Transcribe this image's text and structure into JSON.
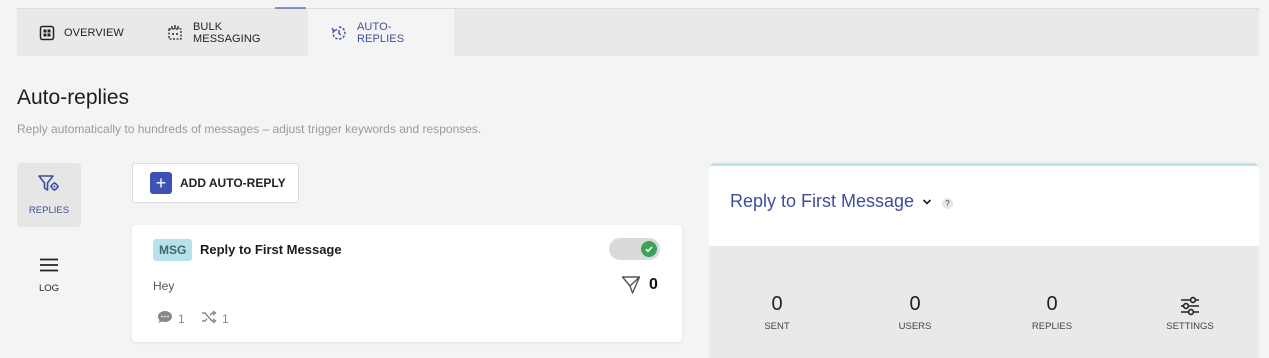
{
  "tabs": [
    {
      "label": "OVERVIEW",
      "icon": "dashboard-icon",
      "active": false
    },
    {
      "label": "BULK MESSAGING",
      "icon": "bulk-message-icon",
      "active": false
    },
    {
      "label": "AUTO-REPLIES",
      "icon": "auto-reply-icon",
      "active": true
    }
  ],
  "page": {
    "title": "Auto-replies",
    "subtitle": "Reply automatically to hundreds of messages – adjust trigger keywords and responses."
  },
  "side": {
    "replies_label": "REPLIES",
    "log_label": "LOG"
  },
  "add_button": {
    "label": "ADD AUTO-REPLY"
  },
  "card": {
    "badge": "MSG",
    "title": "Reply to First Message",
    "message": "Hey",
    "enabled": true,
    "filter_count": "0",
    "comments_count": "1",
    "shuffle_count": "1"
  },
  "panel": {
    "title": "Reply to First Message",
    "help": "?",
    "metrics": {
      "sent": {
        "value": "0",
        "label": "SENT"
      },
      "users": {
        "value": "0",
        "label": "USERS"
      },
      "replies": {
        "value": "0",
        "label": "REPLIES"
      },
      "settings": {
        "label": "SETTINGS"
      }
    }
  },
  "colors": {
    "accent": "#3f51b5",
    "accent_text": "#3f4e9c",
    "toggle_on": "#3aa357",
    "badge_bg": "#b6e2ea"
  }
}
